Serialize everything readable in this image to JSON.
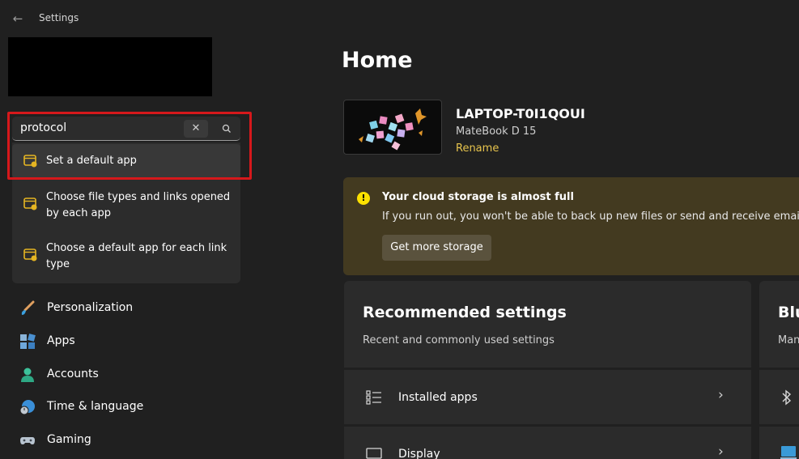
{
  "window": {
    "title": "Settings"
  },
  "search": {
    "value": "protocol",
    "suggestions": [
      {
        "label": "Set a default app"
      },
      {
        "label": "Choose file types and links opened by each app"
      },
      {
        "label": "Choose a default app for each link type"
      }
    ]
  },
  "nav": {
    "items": [
      {
        "label": "Personalization",
        "icon": "brush-icon"
      },
      {
        "label": "Apps",
        "icon": "apps-icon"
      },
      {
        "label": "Accounts",
        "icon": "person-icon"
      },
      {
        "label": "Time & language",
        "icon": "globe-clock-icon"
      },
      {
        "label": "Gaming",
        "icon": "gamepad-icon"
      }
    ]
  },
  "main": {
    "title": "Home",
    "device": {
      "name": "LAPTOP-T0I1QOUI",
      "model": "MateBook D 15",
      "rename_label": "Rename"
    },
    "warning": {
      "title": "Your cloud storage is almost full",
      "body": "If you run out, you won't be able to back up new files or send and receive email in",
      "button": "Get more storage"
    },
    "recommended": {
      "title": "Recommended settings",
      "subtitle": "Recent and commonly used settings",
      "rows": [
        {
          "label": "Installed apps",
          "icon": "list-icon"
        },
        {
          "label": "Display",
          "icon": "monitor-icon"
        }
      ]
    },
    "side_card": {
      "title": "Blu",
      "subtitle": "Man"
    }
  },
  "colors": {
    "background": "#202020",
    "card": "#2b2b2b",
    "accent_link": "#e7c44d",
    "warning_bg": "#433a20",
    "highlight": "#d6181b"
  }
}
